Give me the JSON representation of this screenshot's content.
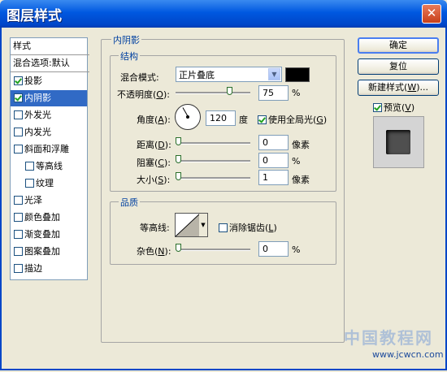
{
  "window": {
    "title": "图层样式",
    "close_glyph": "✕"
  },
  "sidebar": {
    "header": "样式",
    "blend_options": "混合选项:默认",
    "items": [
      {
        "label": "投影",
        "checked": true,
        "indent": false,
        "selected": false
      },
      {
        "label": "内阴影",
        "checked": true,
        "indent": false,
        "selected": true
      },
      {
        "label": "外发光",
        "checked": false,
        "indent": false,
        "selected": false
      },
      {
        "label": "内发光",
        "checked": false,
        "indent": false,
        "selected": false
      },
      {
        "label": "斜面和浮雕",
        "checked": false,
        "indent": false,
        "selected": false
      },
      {
        "label": "等高线",
        "checked": false,
        "indent": true,
        "selected": false
      },
      {
        "label": "纹理",
        "checked": false,
        "indent": true,
        "selected": false
      },
      {
        "label": "光泽",
        "checked": false,
        "indent": false,
        "selected": false
      },
      {
        "label": "颜色叠加",
        "checked": false,
        "indent": false,
        "selected": false
      },
      {
        "label": "渐变叠加",
        "checked": false,
        "indent": false,
        "selected": false
      },
      {
        "label": "图案叠加",
        "checked": false,
        "indent": false,
        "selected": false
      },
      {
        "label": "描边",
        "checked": false,
        "indent": false,
        "selected": false
      }
    ]
  },
  "inner_shadow": {
    "legend": "内阴影",
    "structure": {
      "legend": "结构",
      "blend_mode": {
        "label": "混合模式:",
        "value": "正片叠底"
      },
      "color": "#000000",
      "opacity": {
        "label": "不透明度(",
        "key": "O",
        "tail": "):",
        "value": "75",
        "unit": "%",
        "level": 75
      },
      "angle": {
        "label": "角度(",
        "key": "A",
        "tail": "):",
        "value": "120",
        "unit": "度",
        "degrees": 120
      },
      "global_light": {
        "label": "使用全局光(",
        "key": "G",
        "tail": ")",
        "checked": true
      },
      "distance": {
        "label": "距离(",
        "key": "D",
        "tail": "):",
        "value": "0",
        "unit": "像素",
        "level": 0
      },
      "choke": {
        "label": "阻塞(",
        "key": "C",
        "tail": "):",
        "value": "0",
        "unit": "%",
        "level": 0
      },
      "size": {
        "label": "大小(",
        "key": "S",
        "tail": "):",
        "value": "1",
        "unit": "像素",
        "level": 0
      }
    },
    "quality": {
      "legend": "品质",
      "contour_label": "等高线:",
      "anti_alias": {
        "label": "消除锯齿(",
        "key": "L",
        "tail": ")",
        "checked": false
      },
      "noise": {
        "label": "杂色(",
        "key": "N",
        "tail": "):",
        "value": "0",
        "unit": "%",
        "level": 0
      }
    }
  },
  "buttons": {
    "ok": "确定",
    "reset": "复位",
    "new_style": "新建样式(",
    "new_style_key": "W",
    "new_style_tail": ")...",
    "preview": {
      "label": "预览(",
      "key": "V",
      "tail": ")",
      "checked": true
    }
  },
  "watermark": {
    "title": "中国教程网",
    "url": "www.jcwcn.com"
  }
}
